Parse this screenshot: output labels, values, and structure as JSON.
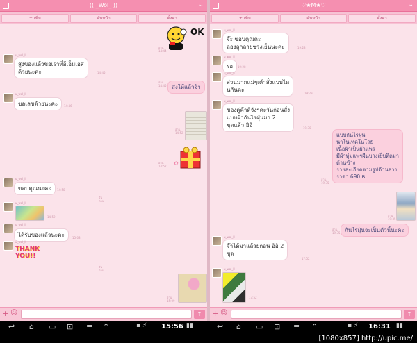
{
  "left": {
    "title": "(( _Wol_ ))",
    "actions": [
      "+ เพิ่ม",
      "คั่นหน้า",
      "ตั้งค่า"
    ],
    "sender_name": "u_wol_ll",
    "messages": [
      {
        "text": "สูงของแล้วขอเราที่อีเอ็มเอส\nด้วยนะคะ",
        "ts": "ก่อน"
      },
      {
        "text": "ส่งให้แล้วจ้า"
      },
      {
        "text": "ขอเลขด้วยนะคะ"
      },
      {
        "text": "ขอบคุณนะคะ"
      },
      {
        "text": "ได้รับของแล้วนะคะ"
      }
    ],
    "stickers": {
      "ok": "OK",
      "thank": "THANK YOU!!"
    }
  },
  "right": {
    "title": "♡★M★♡",
    "actions": [
      "+ เพิ่ม",
      "คั่นหน้า",
      "ตั้งค่า"
    ],
    "sender_name": "u_wol_ll",
    "messages": [
      {
        "text": "จ๊ะ ขอบคุณคะ\nลองลูกลายชวงเย็นนะคะ"
      },
      {
        "text": "รอ"
      },
      {
        "text": "ส่วนมากแม่ๆเค้าสั่งแบบไห\nนกันคะ"
      },
      {
        "text": "ของคู่ค้าดีจังๆคะวันก่อนสั่ง\nแบบผ้ากันไรฝุ่นมา 2\nชุดแล้ว อิอิ"
      },
      {
        "text": "แบบกันไรฝุ่น\nนาโนเทคโนโลยี\nเนื้อผ้าเป็นผ้าแพร\nมีผ้าหุ่มแพรผืนบางเย็บติดมา\nด้านข้าง\nรายละเอียดตามรูปด้านล่าง\nราคา 690 ฿"
      },
      {
        "text": "กันไรฝุ่นจะเป็นตัวนี้นะคะ"
      },
      {
        "text": "จ๊าได้มาแล้วยกอน อิอิ 2\nชุด"
      }
    ]
  },
  "status": {
    "time_left": "15:56",
    "time_right": "16:31"
  },
  "watermark": "[1080x857] http://upic.me/",
  "colors": {
    "titlebar": "#f58fb0",
    "background": "#fbe3ea",
    "outgoing": "#fbd0de",
    "incoming": "#ffffff"
  }
}
